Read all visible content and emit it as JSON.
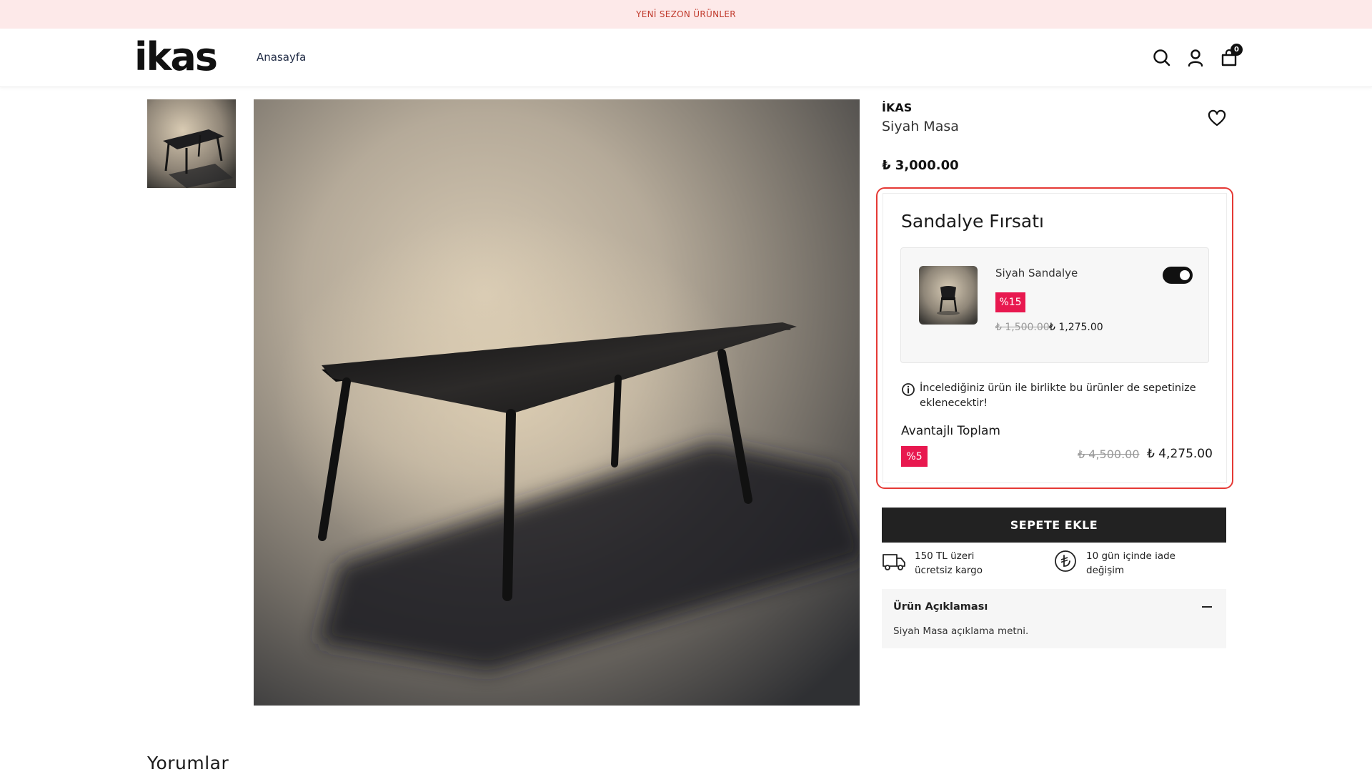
{
  "announcement": {
    "text": "YENİ SEZON ÜRÜNLER"
  },
  "header": {
    "logo": "ikas",
    "nav": [
      {
        "label": "Anasayfa"
      }
    ],
    "icons": [
      "search-icon",
      "user-icon",
      "cart-icon"
    ],
    "cart_count": "0"
  },
  "gallery": {
    "thumbnail": "table-thumbnail",
    "main_image": "black-table-photo"
  },
  "product": {
    "brand": "İKAS",
    "name": "Siyah Masa",
    "price": "₺ 3,000.00",
    "wishlist_icon": "heart-icon"
  },
  "bundle_offer": {
    "title": "Sandalye Fırsatı",
    "item": {
      "name": "Siyah Sandalye",
      "discount": "%15",
      "old_price": "₺ 1,500.00",
      "new_price": "₺ 1,275.00",
      "toggle_on": true
    },
    "info_text": "İncelediğiniz ürün ile birlikte bu ürünler de sepetinize eklenecektir!",
    "total_title": "Avantajlı Toplam",
    "total_discount": "%5",
    "total_old": "₺ 4,500.00",
    "total_new": "₺ 4,275.00"
  },
  "add_to_cart": {
    "label": "SEPETE EKLE"
  },
  "features": [
    {
      "icon": "truck-icon",
      "text": "150 TL üzeri ücretsiz kargo"
    },
    {
      "icon": "lira-icon",
      "text": "10 gün içinde iade değişim"
    }
  ],
  "description": {
    "title": "Ürün Açıklaması",
    "text": "Siyah Masa açıklama metni."
  },
  "reviews": {
    "title": "Yorumlar"
  },
  "colors": {
    "announcement_bg": "#fde9e9",
    "accent_red": "#e53935",
    "badge": "#e8184f",
    "button": "#222222"
  }
}
